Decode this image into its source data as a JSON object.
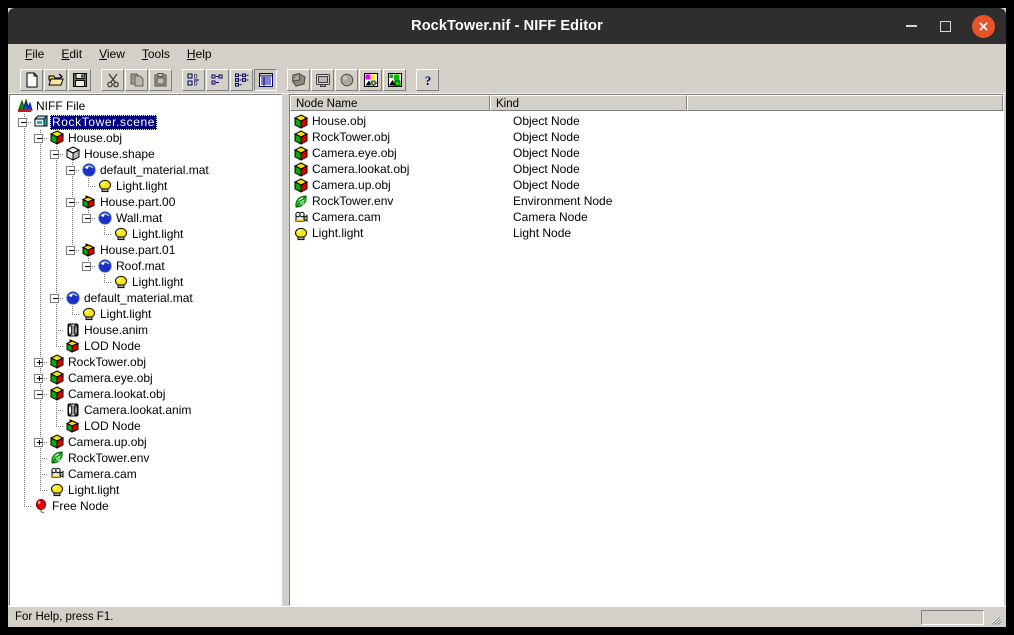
{
  "window": {
    "title": "RockTower.nif - NIFF Editor",
    "minimize_label": "Minimize",
    "maximize_label": "Maximize",
    "close_label": "Close"
  },
  "menubar": {
    "items": [
      {
        "label": "File",
        "accel": "F"
      },
      {
        "label": "Edit",
        "accel": "E"
      },
      {
        "label": "View",
        "accel": "V"
      },
      {
        "label": "Tools",
        "accel": "T"
      },
      {
        "label": "Help",
        "accel": "H"
      }
    ]
  },
  "toolbar": {
    "buttons": [
      {
        "name": "new-file-button",
        "icon": "new-document-icon",
        "state": "raised"
      },
      {
        "name": "open-file-button",
        "icon": "open-folder-icon",
        "state": "raised"
      },
      {
        "name": "save-file-button",
        "icon": "floppy-save-icon",
        "state": "raised"
      },
      {
        "name": "cut-button",
        "icon": "scissors-icon",
        "state": "raised"
      },
      {
        "name": "copy-button",
        "icon": "copy-pages-icon",
        "state": "raised"
      },
      {
        "name": "paste-button",
        "icon": "clipboard-paste-icon",
        "state": "raised"
      },
      {
        "name": "view-large-icons-button",
        "icon": "large-icons-icon",
        "state": "raised"
      },
      {
        "name": "view-small-icons-button",
        "icon": "small-icons-icon",
        "state": "raised"
      },
      {
        "name": "view-list-button",
        "icon": "list-view-icon",
        "state": "raised"
      },
      {
        "name": "view-details-button",
        "icon": "details-view-icon",
        "state": "pressed"
      },
      {
        "name": "shape-tool-button",
        "icon": "shape-polygon-icon",
        "state": "raised"
      },
      {
        "name": "screen-tool-button",
        "icon": "monitor-screen-icon",
        "state": "raised"
      },
      {
        "name": "material-tool-button",
        "icon": "sphere-material-icon",
        "state": "raised"
      },
      {
        "name": "import-image-button",
        "icon": "image-import-icon",
        "state": "raised"
      },
      {
        "name": "export-image-button",
        "icon": "image-export-icon",
        "state": "raised"
      },
      {
        "name": "help-button",
        "icon": "question-mark-icon",
        "state": "raised"
      }
    ]
  },
  "tree": {
    "nodes": [
      {
        "label": "NIFF File",
        "depth": 0,
        "icon": "niff-file-icon",
        "expander": "none",
        "selected": false,
        "last": false
      },
      {
        "label": "RockTower.scene",
        "depth": 1,
        "icon": "scene-icon",
        "expander": "minus",
        "selected": true,
        "last": false
      },
      {
        "label": "House.obj",
        "depth": 2,
        "icon": "object-node-icon",
        "expander": "minus",
        "selected": false,
        "last": false
      },
      {
        "label": "House.shape",
        "depth": 3,
        "icon": "shape-icon",
        "expander": "minus",
        "selected": false,
        "last": false
      },
      {
        "label": "default_material.mat",
        "depth": 4,
        "icon": "material-icon",
        "expander": "minus",
        "selected": false,
        "last": false
      },
      {
        "label": "Light.light",
        "depth": 5,
        "icon": "light-icon",
        "expander": "none",
        "selected": false,
        "last": true
      },
      {
        "label": "House.part.00",
        "depth": 4,
        "icon": "part-icon",
        "expander": "minus",
        "selected": false,
        "last": false
      },
      {
        "label": "Wall.mat",
        "depth": 5,
        "icon": "material-icon",
        "expander": "minus",
        "selected": false,
        "last": false
      },
      {
        "label": "Light.light",
        "depth": 6,
        "icon": "light-icon",
        "expander": "none",
        "selected": false,
        "last": true
      },
      {
        "label": "House.part.01",
        "depth": 4,
        "icon": "part-icon",
        "expander": "minus",
        "selected": false,
        "last": true
      },
      {
        "label": "Roof.mat",
        "depth": 5,
        "icon": "material-icon",
        "expander": "minus",
        "selected": false,
        "last": true
      },
      {
        "label": "Light.light",
        "depth": 6,
        "icon": "light-icon",
        "expander": "none",
        "selected": false,
        "last": true
      },
      {
        "label": "default_material.mat",
        "depth": 3,
        "icon": "material-icon",
        "expander": "minus",
        "selected": false,
        "last": false
      },
      {
        "label": "Light.light",
        "depth": 4,
        "icon": "light-icon",
        "expander": "none",
        "selected": false,
        "last": true
      },
      {
        "label": "House.anim",
        "depth": 3,
        "icon": "anim-icon",
        "expander": "none",
        "selected": false,
        "last": false
      },
      {
        "label": "LOD Node",
        "depth": 3,
        "icon": "lod-icon",
        "expander": "none",
        "selected": false,
        "last": true
      },
      {
        "label": "RockTower.obj",
        "depth": 2,
        "icon": "object-node-icon",
        "expander": "plus",
        "selected": false,
        "last": false
      },
      {
        "label": "Camera.eye.obj",
        "depth": 2,
        "icon": "object-node-icon",
        "expander": "plus",
        "selected": false,
        "last": false
      },
      {
        "label": "Camera.lookat.obj",
        "depth": 2,
        "icon": "object-node-icon",
        "expander": "minus",
        "selected": false,
        "last": false
      },
      {
        "label": "Camera.lookat.anim",
        "depth": 3,
        "icon": "anim-icon",
        "expander": "none",
        "selected": false,
        "last": false
      },
      {
        "label": "LOD Node",
        "depth": 3,
        "icon": "lod-icon",
        "expander": "none",
        "selected": false,
        "last": true
      },
      {
        "label": "Camera.up.obj",
        "depth": 2,
        "icon": "object-node-icon",
        "expander": "plus",
        "selected": false,
        "last": false
      },
      {
        "label": "RockTower.env",
        "depth": 2,
        "icon": "env-icon",
        "expander": "none",
        "selected": false,
        "last": false
      },
      {
        "label": "Camera.cam",
        "depth": 2,
        "icon": "camera-icon",
        "expander": "none",
        "selected": false,
        "last": false
      },
      {
        "label": "Light.light",
        "depth": 2,
        "icon": "light-icon",
        "expander": "none",
        "selected": false,
        "last": true
      },
      {
        "label": "Free Node",
        "depth": 1,
        "icon": "free-node-icon",
        "expander": "none",
        "selected": false,
        "last": true
      }
    ]
  },
  "list": {
    "columns": [
      {
        "label": "Node Name"
      },
      {
        "label": "Kind"
      },
      {
        "label": ""
      }
    ],
    "rows": [
      {
        "name": "House.obj",
        "kind": "Object Node",
        "icon": "object-node-icon"
      },
      {
        "name": "RockTower.obj",
        "kind": "Object Node",
        "icon": "object-node-icon"
      },
      {
        "name": "Camera.eye.obj",
        "kind": "Object Node",
        "icon": "object-node-icon"
      },
      {
        "name": "Camera.lookat.obj",
        "kind": "Object Node",
        "icon": "object-node-icon"
      },
      {
        "name": "Camera.up.obj",
        "kind": "Object Node",
        "icon": "object-node-icon"
      },
      {
        "name": "RockTower.env",
        "kind": "Environment Node",
        "icon": "env-icon"
      },
      {
        "name": "Camera.cam",
        "kind": "Camera Node",
        "icon": "camera-icon"
      },
      {
        "name": "Light.light",
        "kind": "Light Node",
        "icon": "light-icon"
      }
    ]
  },
  "statusbar": {
    "text": "For Help, press F1."
  },
  "colors": {
    "titlebar_bg": "#2e2e2e",
    "close_button": "#e8542a",
    "window_face": "#d4d0c8",
    "selection": "#000080",
    "pane_bg": "#ffffff"
  }
}
